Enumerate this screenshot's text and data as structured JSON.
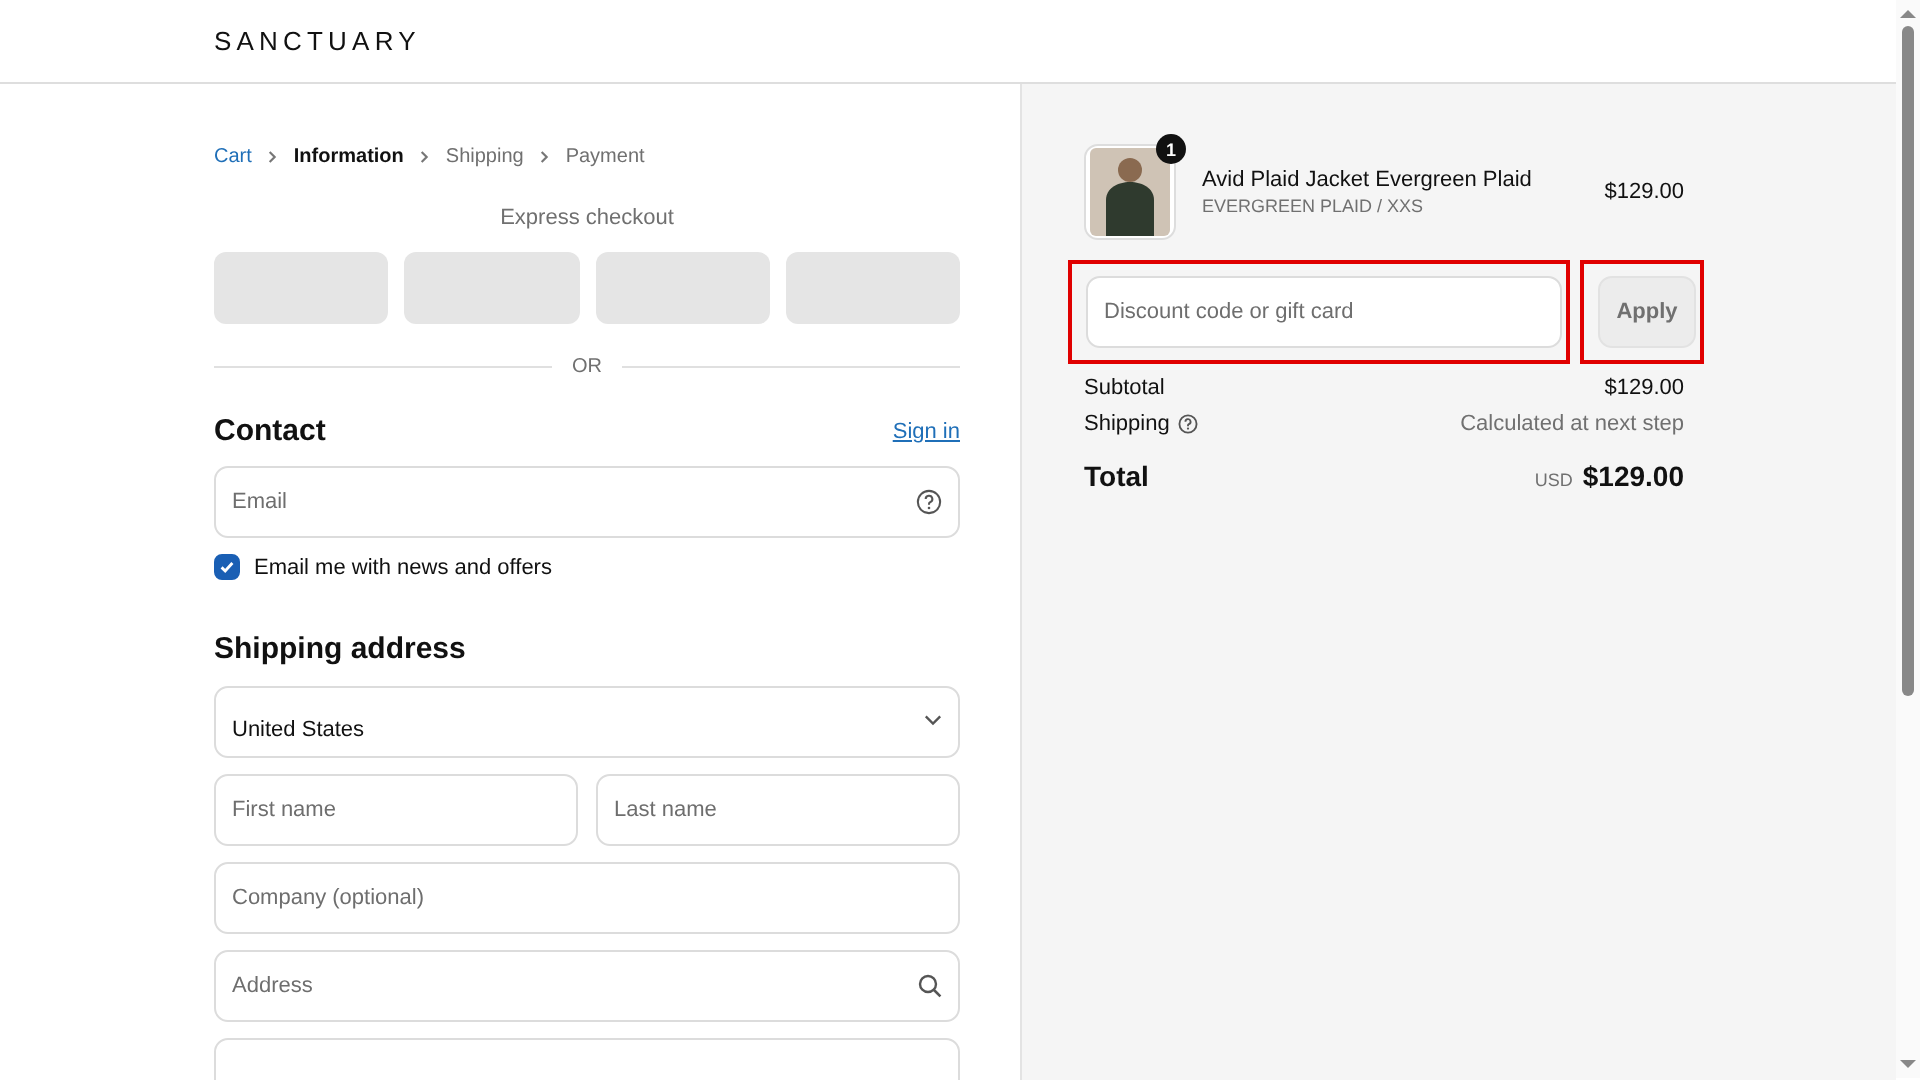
{
  "header": {
    "logo": "SANCTUARY"
  },
  "breadcrumb": [
    {
      "label": "Cart",
      "kind": "link"
    },
    {
      "label": "Information",
      "kind": "current"
    },
    {
      "label": "Shipping",
      "kind": "pending"
    },
    {
      "label": "Payment",
      "kind": "pending"
    }
  ],
  "express_checkout": {
    "title": "Express checkout",
    "buttons": [
      {
        "kind": "wallet"
      },
      {
        "kind": "wallet"
      },
      {
        "kind": "wallet"
      },
      {
        "kind": "wallet"
      }
    ]
  },
  "divider_label": "OR",
  "contact": {
    "heading": "Contact",
    "sign_in": "Sign in",
    "email": {
      "placeholder": "Email",
      "help": true
    },
    "newsletter": {
      "label": "Email me with news and offers",
      "checked": true
    }
  },
  "shipping_address": {
    "heading": "Shipping address",
    "rows": [
      [
        {
          "kind": "select",
          "value": "United States"
        }
      ],
      [
        {
          "kind": "text",
          "placeholder": "First name"
        },
        {
          "kind": "text",
          "placeholder": "Last name"
        }
      ],
      [
        {
          "kind": "text",
          "placeholder": "Company (optional)"
        }
      ],
      [
        {
          "kind": "search",
          "placeholder": "Address"
        }
      ],
      [
        {
          "kind": "text"
        }
      ]
    ]
  },
  "summary": {
    "items": [
      {
        "title": "Avid Plaid Jacket Evergreen Plaid",
        "variant": "EVERGREEN PLAID / XXS",
        "price": "$129.00",
        "quantity": "1"
      }
    ],
    "discount": {
      "placeholder": "Discount code or gift card",
      "highlighted": true
    },
    "apply": {
      "label": "Apply",
      "highlighted": true
    },
    "lines": [
      {
        "label": "Subtotal",
        "value": "$129.00",
        "info": false
      },
      {
        "label": "Shipping",
        "value": "Calculated at next step",
        "info": true
      }
    ],
    "total": {
      "label": "Total",
      "currency": "USD",
      "value": "$129.00"
    }
  }
}
